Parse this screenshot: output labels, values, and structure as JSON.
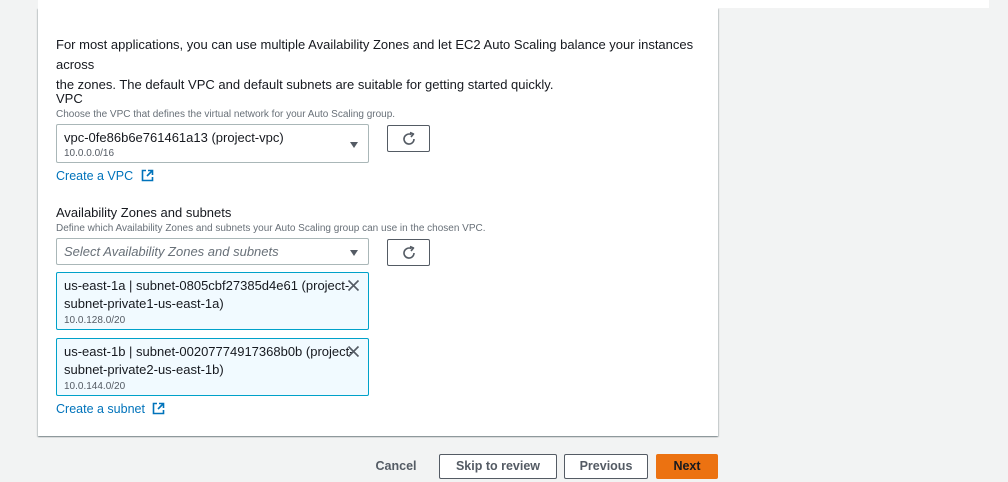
{
  "intro": {
    "line1": "For most applications, you can use multiple Availability Zones and let EC2 Auto Scaling balance your instances across",
    "line2": "the zones. The default VPC and default subnets are suitable for getting started quickly."
  },
  "vpc": {
    "label": "VPC",
    "description": "Choose the VPC that defines the virtual network for your Auto Scaling group.",
    "selected_value": "vpc-0fe86b6e761461a13 (project-vpc)",
    "selected_cidr": "10.0.0.0/16",
    "create_link": "Create a VPC"
  },
  "subnets": {
    "label": "Availability Zones and subnets",
    "description": "Define which Availability Zones and subnets your Auto Scaling group can use in the chosen VPC.",
    "placeholder": "Select Availability Zones and subnets",
    "tokens": [
      {
        "line1": "us-east-1a | subnet-0805cbf27385d4e61 (project-",
        "line2": "subnet-private1-us-east-1a)",
        "cidr": "10.0.128.0/20"
      },
      {
        "line1": "us-east-1b | subnet-00207774917368b0b (project-",
        "line2": "subnet-private2-us-east-1b)",
        "cidr": "10.0.144.0/20"
      }
    ],
    "create_link": "Create a subnet"
  },
  "footer": {
    "cancel": "Cancel",
    "skip": "Skip to review",
    "previous": "Previous",
    "next": "Next"
  },
  "icons": {
    "refresh": "refresh-icon",
    "external": "external-link-icon",
    "dismiss": "close-icon",
    "dropdown": "caret-down-icon"
  },
  "colors": {
    "link": "#0073bb",
    "primary_button": "#ec7211",
    "token_bg": "#f1faff",
    "token_border": "#00a1c9"
  }
}
